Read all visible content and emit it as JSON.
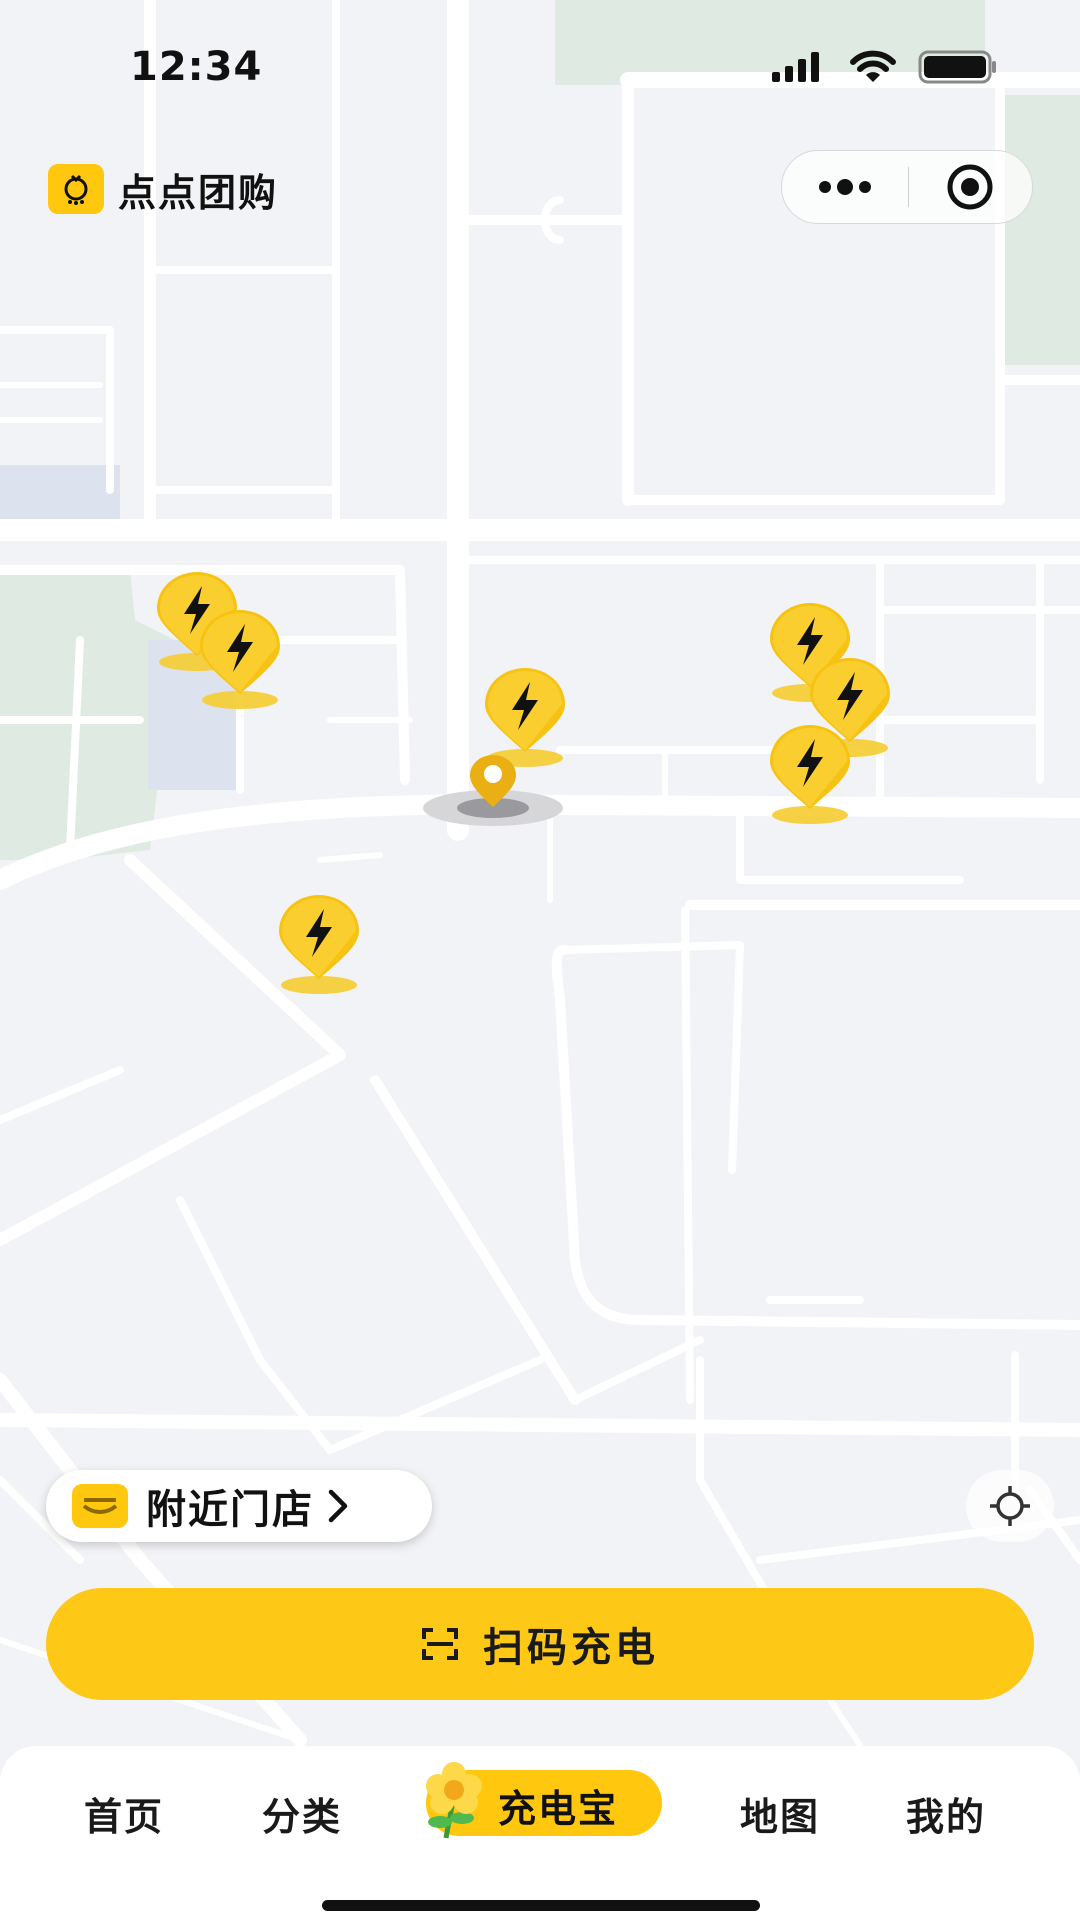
{
  "status_bar": {
    "time": "12:34"
  },
  "header": {
    "app_name": "点点团购",
    "logo_icon": "shop-mascot-icon"
  },
  "capsule": {
    "more_icon": "more-dots-icon",
    "close_icon": "target-circle-icon"
  },
  "map": {
    "marker_icon": "lightning-bolt-icon",
    "marker_count": 7,
    "user_location_icon": "location-pin-icon"
  },
  "nearby_stores": {
    "label": "附近门店",
    "icon": "store-icon"
  },
  "locate_button": {
    "icon": "crosshair-icon"
  },
  "scan_button": {
    "label": "扫码充电",
    "icon": "scan-icon"
  },
  "tabbar": {
    "tabs": [
      {
        "label": "首页"
      },
      {
        "label": "分类"
      },
      {
        "label": "充电宝",
        "active": true,
        "icon": "flower-icon"
      },
      {
        "label": "地图"
      },
      {
        "label": "我的"
      }
    ]
  },
  "colors": {
    "accent": "#FEC817",
    "map_background": "#F2F3F6",
    "road": "#FFFFFF",
    "park": "#DFEBE2",
    "water": "#DCE3EF"
  }
}
